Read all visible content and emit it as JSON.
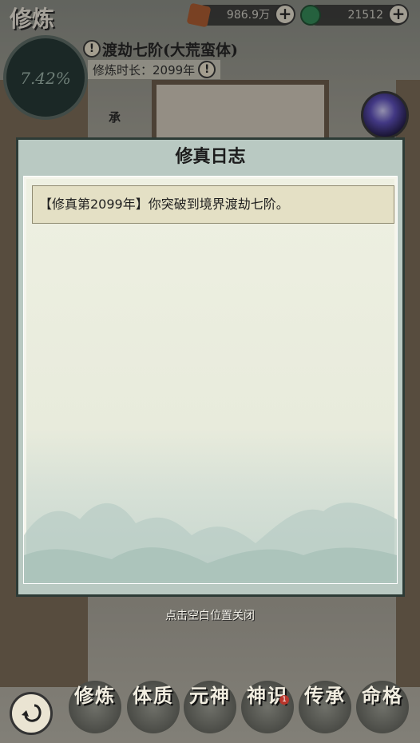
{
  "header": {
    "title": "修炼"
  },
  "resources": [
    {
      "icon": "spirit-stone-icon",
      "value": "986.9万"
    },
    {
      "icon": "jade-coin-icon",
      "value": "21512"
    }
  ],
  "cultivation": {
    "progress": "7.42%",
    "progress_fraction": 0.0742,
    "realm": "渡劫七阶(大荒蛮体)",
    "duration": "修炼时长：2099年"
  },
  "side_labels": {
    "left": "承"
  },
  "modal": {
    "title": "修真日志",
    "entries": [
      "【修真第2099年】你突破到境界渡劫七阶。"
    ]
  },
  "close_hint": "点击空白位置关闭",
  "nav": {
    "items": [
      {
        "label": "修炼"
      },
      {
        "label": "体质"
      },
      {
        "label": "元神"
      },
      {
        "label": "神识",
        "badge": "1"
      },
      {
        "label": "传承"
      },
      {
        "label": "命格"
      }
    ]
  },
  "colors": {
    "modal_frame": "#b9c9c2",
    "paper": "#eef0e2",
    "log_entry": "#e4e0c5",
    "badge": "#b8352b"
  }
}
